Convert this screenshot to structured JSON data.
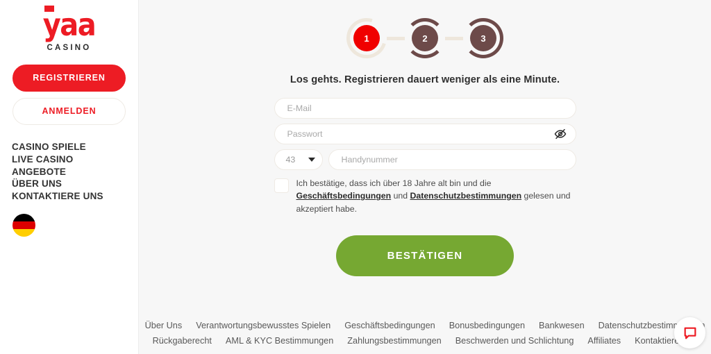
{
  "sidebar": {
    "logo": {
      "mark": "yaa",
      "sub": "CASINO"
    },
    "register_label": "REGISTRIEREN",
    "login_label": "ANMELDEN",
    "nav": [
      {
        "label": "CASINO SPIELE"
      },
      {
        "label": "LIVE CASINO"
      },
      {
        "label": "ANGEBOTE"
      },
      {
        "label": "ÜBER UNS"
      },
      {
        "label": "KONTAKTIERE UNS"
      }
    ],
    "language_flag": "de-flag"
  },
  "stepper": {
    "steps": [
      {
        "number": "1",
        "state": "active"
      },
      {
        "number": "2",
        "state": "idle"
      },
      {
        "number": "3",
        "state": "idle"
      }
    ],
    "active_color": "#f00000",
    "idle_color": "#6d4a49",
    "track_color": "#eee7dc"
  },
  "form": {
    "heading": "Los gehts. Registrieren dauert weniger als eine Minute.",
    "email": {
      "value": "",
      "placeholder": "E-Mail"
    },
    "password": {
      "value": "",
      "placeholder": "Passwort",
      "toggle_icon": "eye-off-icon"
    },
    "country_code": {
      "value": "43",
      "caret_icon": "chevron-down-icon"
    },
    "phone": {
      "value": "",
      "placeholder": "Handynummer"
    },
    "terms": {
      "part1": "Ich bestätige, dass ich über 18 Jahre alt bin und die ",
      "link1": "Geschäftsbedingungen",
      "part2": " und ",
      "link2": "Datenschutzbestimmungen",
      "part3": " gelesen und akzeptiert habe.",
      "checked": false
    },
    "submit_label": "BESTÄTIGEN",
    "submit_color": "#76a832"
  },
  "footer": {
    "row1": [
      {
        "label": "Über Uns"
      },
      {
        "label": "Verantwortungsbewusstes Spielen"
      },
      {
        "label": "Geschäftsbedingungen"
      },
      {
        "label": "Bonusbedingungen"
      },
      {
        "label": "Bankwesen"
      },
      {
        "label": "Datenschutzbestimmungen"
      }
    ],
    "row2": [
      {
        "label": "Rückgaberecht"
      },
      {
        "label": "AML & KYC Bestimmungen"
      },
      {
        "label": "Zahlungsbestimmungen"
      },
      {
        "label": "Beschwerden und Schlichtung"
      },
      {
        "label": "Affiliates"
      },
      {
        "label": "Kontaktiere Uns"
      }
    ]
  },
  "chat": {
    "icon": "chat-bubble-icon",
    "color": "#ed1c24"
  }
}
